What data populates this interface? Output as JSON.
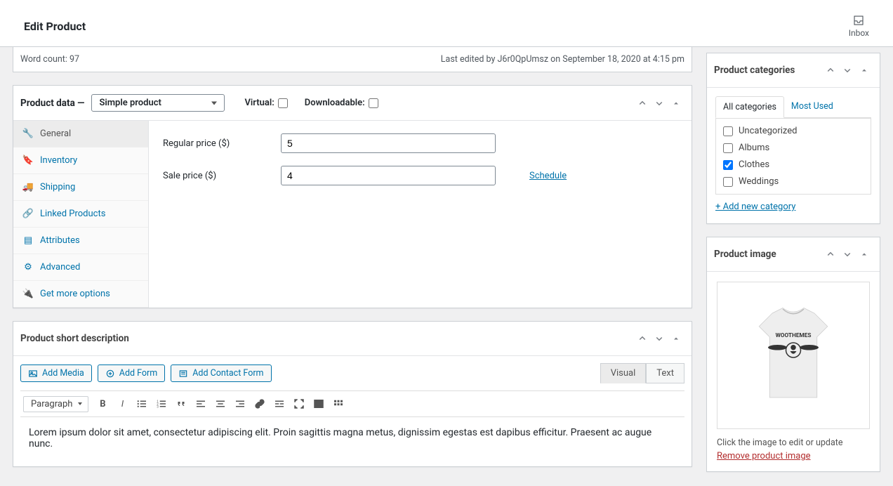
{
  "header": {
    "title": "Edit Product",
    "inbox": "Inbox"
  },
  "wordcount": {
    "text": "Word count: 97",
    "last_edited": "Last edited by J6r0QpUmsz on September 18, 2020 at 4:15 pm"
  },
  "product_data": {
    "title": "Product data —",
    "type_select": "Simple product",
    "virtual_label": "Virtual:",
    "downloadable_label": "Downloadable:",
    "tabs": {
      "general": "General",
      "inventory": "Inventory",
      "shipping": "Shipping",
      "linked": "Linked Products",
      "attributes": "Attributes",
      "advanced": "Advanced",
      "more": "Get more options"
    },
    "fields": {
      "regular_label": "Regular price ($)",
      "regular_value": "5",
      "sale_label": "Sale price ($)",
      "sale_value": "4",
      "schedule": "Schedule"
    }
  },
  "short_desc": {
    "title": "Product short description",
    "add_media": "Add Media",
    "add_form": "Add Form",
    "add_contact": "Add Contact Form",
    "visual": "Visual",
    "text": "Text",
    "paragraph": "Paragraph",
    "content": "Lorem ipsum dolor sit amet, consectetur adipiscing elit. Proin sagittis magna metus, dignissim egestas est dapibus efficitur. Praesent ac augue nunc."
  },
  "categories": {
    "title": "Product categories",
    "tab_all": "All categories",
    "tab_most": "Most Used",
    "items": {
      "uncat": "Uncategorized",
      "albums": "Albums",
      "clothes": "Clothes",
      "weddings": "Weddings"
    },
    "add_new": "+ Add new category"
  },
  "product_image": {
    "title": "Product image",
    "hint": "Click the image to edit or update",
    "remove": "Remove product image",
    "tshirt_text": "WOOTHEMES"
  }
}
